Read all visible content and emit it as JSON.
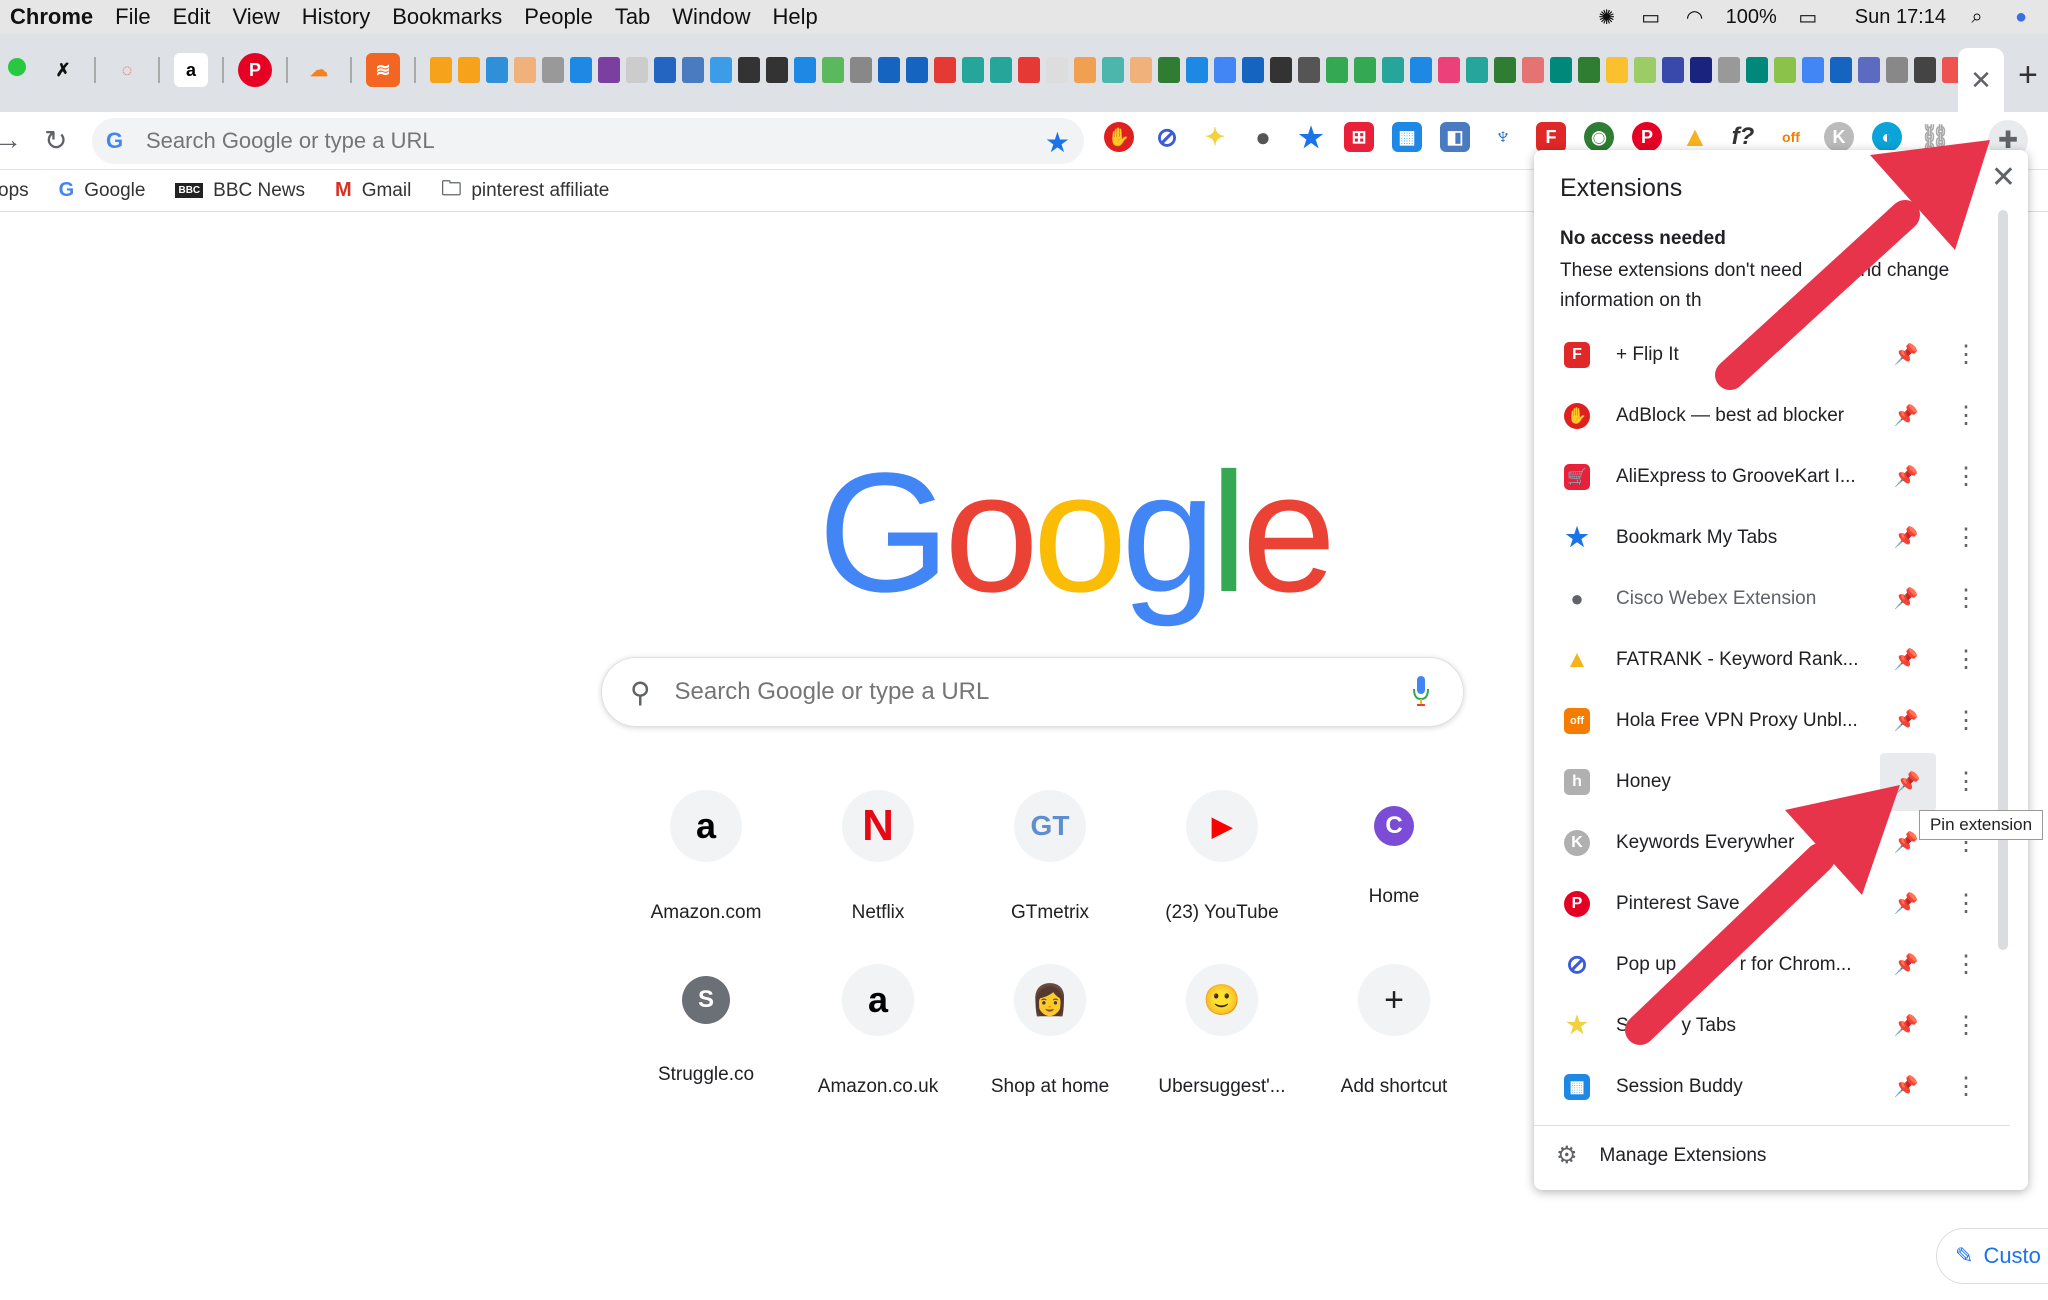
{
  "menubar": {
    "app": "Chrome",
    "items": [
      "File",
      "Edit",
      "View",
      "History",
      "Bookmarks",
      "People",
      "Tab",
      "Window",
      "Help"
    ],
    "battery": "100%",
    "clock": "Sun 17:14"
  },
  "toolbar": {
    "omnibox_placeholder": "Search Google or type a URL"
  },
  "bookmarks": [
    {
      "label": "ops",
      "icon": ""
    },
    {
      "label": "Google",
      "icon": "G"
    },
    {
      "label": "BBC News",
      "icon": "BBC"
    },
    {
      "label": "Gmail",
      "icon": "M"
    },
    {
      "label": "pinterest affiliate",
      "icon": "folder-icon"
    }
  ],
  "ntp": {
    "logo": "Google",
    "search_placeholder": "Search Google or type a URL",
    "shortcuts": [
      {
        "label": "Amazon.com",
        "glyph": "a",
        "color": "#000000"
      },
      {
        "label": "Netflix",
        "glyph": "N",
        "color": "#e50914"
      },
      {
        "label": "GTmetrix",
        "glyph": "GT",
        "color": "#5d8fd0"
      },
      {
        "label": "(23) YouTube",
        "glyph": "▶",
        "color": "#ff0000"
      },
      {
        "label": "Home",
        "glyph": "C",
        "color": "#7b4dd6"
      },
      {
        "label": "Struggle.co",
        "glyph": "S",
        "color": "#ffffff"
      },
      {
        "label": "Amazon.co.uk",
        "glyph": "a",
        "color": "#000000"
      },
      {
        "label": "Shop at home",
        "glyph": "👩",
        "color": "#8a5a3b"
      },
      {
        "label": "Ubersuggest'...",
        "glyph": "🙂",
        "color": "#000000"
      },
      {
        "label": "Add shortcut",
        "glyph": "+",
        "color": "#202124"
      }
    ],
    "customize_label": "Custo"
  },
  "extensions_popup": {
    "title": "Extensions",
    "section_title": "No access needed",
    "section_desc": "These extensions don't need      e and change information on th",
    "items": [
      {
        "name": "+ Flip It",
        "color": "#e12828",
        "glyph": "F"
      },
      {
        "name": "AdBlock — best ad blocker",
        "color": "#e02020",
        "glyph": "✋"
      },
      {
        "name": "AliExpress to GrooveKart I...",
        "color": "#e8203a",
        "glyph": "🛒"
      },
      {
        "name": "Bookmark My Tabs",
        "color": "#1a73e8",
        "glyph": "★"
      },
      {
        "name": "Cisco Webex Extension",
        "color": "#5f6368",
        "glyph": "●"
      },
      {
        "name": "FATRANK - Keyword Rank...",
        "color": "#f6b21b",
        "glyph": "▲"
      },
      {
        "name": "Hola Free VPN Proxy Unbl...",
        "color": "#f57c00",
        "glyph": "off"
      },
      {
        "name": "Honey",
        "color": "#b0b0b0",
        "glyph": "h"
      },
      {
        "name": "Keywords Everywher",
        "color": "#b0b0b0",
        "glyph": "K"
      },
      {
        "name": "Pinterest Save",
        "color": "#e60023",
        "glyph": "P"
      },
      {
        "name": "Pop up            r for Chrom...",
        "color": "#3b5bdb",
        "glyph": "⊘"
      },
      {
        "name": "S          y Tabs",
        "color": "#f2d13c",
        "glyph": "★"
      },
      {
        "name": "Session Buddy",
        "color": "#1e88e5",
        "glyph": "▦"
      }
    ],
    "manage_label": "Manage Extensions",
    "tooltip": "Pin extension"
  },
  "colors": {
    "accent": "#1a73e8",
    "arrow": "#e8344a"
  }
}
